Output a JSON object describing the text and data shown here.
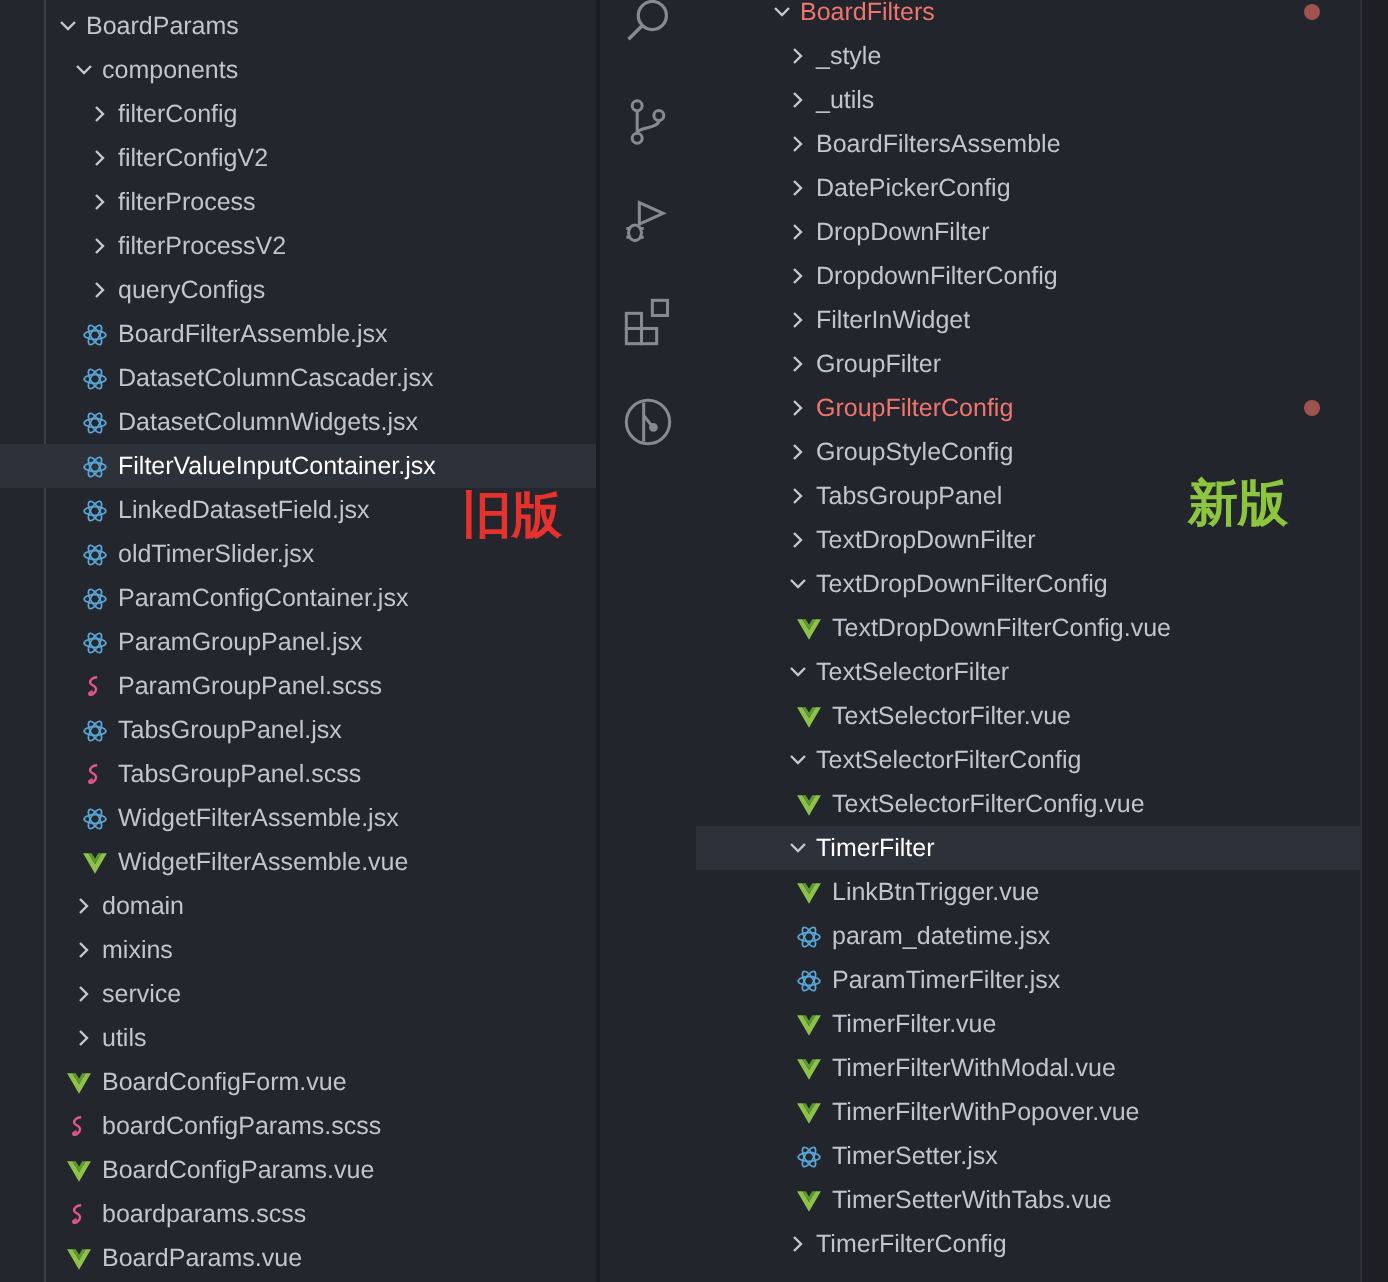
{
  "left_explorer": {
    "annotation": {
      "text": "旧版",
      "color": "#e5322d"
    },
    "tree": [
      {
        "kind": "folder",
        "name": "BoardParams",
        "expanded": true,
        "selected": false,
        "children": [
          {
            "kind": "folder",
            "name": "components",
            "expanded": true,
            "selected": false,
            "children": [
              {
                "kind": "folder",
                "name": "filterConfig",
                "expanded": false,
                "selected": false
              },
              {
                "kind": "folder",
                "name": "filterConfigV2",
                "expanded": false,
                "selected": false
              },
              {
                "kind": "folder",
                "name": "filterProcess",
                "expanded": false,
                "selected": false
              },
              {
                "kind": "folder",
                "name": "filterProcessV2",
                "expanded": false,
                "selected": false
              },
              {
                "kind": "folder",
                "name": "queryConfigs",
                "expanded": false,
                "selected": false
              },
              {
                "kind": "jsx",
                "name": "BoardFilterAssemble.jsx",
                "selected": false
              },
              {
                "kind": "jsx",
                "name": "DatasetColumnCascader.jsx",
                "selected": false
              },
              {
                "kind": "jsx",
                "name": "DatasetColumnWidgets.jsx",
                "selected": false
              },
              {
                "kind": "jsx",
                "name": "FilterValueInputContainer.jsx",
                "selected": true
              },
              {
                "kind": "jsx",
                "name": "LinkedDatasetField.jsx",
                "selected": false
              },
              {
                "kind": "jsx",
                "name": "oldTimerSlider.jsx",
                "selected": false
              },
              {
                "kind": "jsx",
                "name": "ParamConfigContainer.jsx",
                "selected": false
              },
              {
                "kind": "jsx",
                "name": "ParamGroupPanel.jsx",
                "selected": false
              },
              {
                "kind": "scss",
                "name": "ParamGroupPanel.scss",
                "selected": false
              },
              {
                "kind": "jsx",
                "name": "TabsGroupPanel.jsx",
                "selected": false
              },
              {
                "kind": "scss",
                "name": "TabsGroupPanel.scss",
                "selected": false
              },
              {
                "kind": "jsx",
                "name": "WidgetFilterAssemble.jsx",
                "selected": false
              },
              {
                "kind": "vue",
                "name": "WidgetFilterAssemble.vue",
                "selected": false
              }
            ]
          },
          {
            "kind": "folder",
            "name": "domain",
            "expanded": false,
            "selected": false
          },
          {
            "kind": "folder",
            "name": "mixins",
            "expanded": false,
            "selected": false
          },
          {
            "kind": "folder",
            "name": "service",
            "expanded": false,
            "selected": false
          },
          {
            "kind": "folder",
            "name": "utils",
            "expanded": false,
            "selected": false
          },
          {
            "kind": "vue",
            "name": "BoardConfigForm.vue",
            "selected": false
          },
          {
            "kind": "scss",
            "name": "boardConfigParams.scss",
            "selected": false
          },
          {
            "kind": "vue",
            "name": "BoardConfigParams.vue",
            "selected": false
          },
          {
            "kind": "scss",
            "name": "boardparams.scss",
            "selected": false
          },
          {
            "kind": "vue",
            "name": "BoardParams.vue",
            "selected": false
          }
        ]
      }
    ]
  },
  "right_explorer": {
    "annotation": {
      "text": "新版",
      "color": "#8cc63f"
    },
    "tree": [
      {
        "kind": "folder",
        "name": "BoardFilters",
        "expanded": true,
        "selected": false,
        "modified": true,
        "children": [
          {
            "kind": "folder",
            "name": "_style",
            "expanded": false,
            "selected": false,
            "modified": false
          },
          {
            "kind": "folder",
            "name": "_utils",
            "expanded": false,
            "selected": false,
            "modified": false
          },
          {
            "kind": "folder",
            "name": "BoardFiltersAssemble",
            "expanded": false,
            "selected": false,
            "modified": false
          },
          {
            "kind": "folder",
            "name": "DatePickerConfig",
            "expanded": false,
            "selected": false,
            "modified": false
          },
          {
            "kind": "folder",
            "name": "DropDownFilter",
            "expanded": false,
            "selected": false,
            "modified": false
          },
          {
            "kind": "folder",
            "name": "DropdownFilterConfig",
            "expanded": false,
            "selected": false,
            "modified": false
          },
          {
            "kind": "folder",
            "name": "FilterInWidget",
            "expanded": false,
            "selected": false,
            "modified": false
          },
          {
            "kind": "folder",
            "name": "GroupFilter",
            "expanded": false,
            "selected": false,
            "modified": false
          },
          {
            "kind": "folder",
            "name": "GroupFilterConfig",
            "expanded": false,
            "selected": false,
            "modified": true
          },
          {
            "kind": "folder",
            "name": "GroupStyleConfig",
            "expanded": false,
            "selected": false,
            "modified": false
          },
          {
            "kind": "folder",
            "name": "TabsGroupPanel",
            "expanded": false,
            "selected": false,
            "modified": false
          },
          {
            "kind": "folder",
            "name": "TextDropDownFilter",
            "expanded": false,
            "selected": false,
            "modified": false
          },
          {
            "kind": "folder",
            "name": "TextDropDownFilterConfig",
            "expanded": true,
            "selected": false,
            "modified": false,
            "children": [
              {
                "kind": "vue",
                "name": "TextDropDownFilterConfig.vue",
                "selected": false,
                "modified": false
              }
            ]
          },
          {
            "kind": "folder",
            "name": "TextSelectorFilter",
            "expanded": true,
            "selected": false,
            "modified": false,
            "children": [
              {
                "kind": "vue",
                "name": "TextSelectorFilter.vue",
                "selected": false,
                "modified": false
              }
            ]
          },
          {
            "kind": "folder",
            "name": "TextSelectorFilterConfig",
            "expanded": true,
            "selected": false,
            "modified": false,
            "children": [
              {
                "kind": "vue",
                "name": "TextSelectorFilterConfig.vue",
                "selected": false,
                "modified": false
              }
            ]
          },
          {
            "kind": "folder",
            "name": "TimerFilter",
            "expanded": true,
            "selected": true,
            "modified": false,
            "children": [
              {
                "kind": "vue",
                "name": "LinkBtnTrigger.vue",
                "selected": false,
                "modified": false
              },
              {
                "kind": "jsx",
                "name": "param_datetime.jsx",
                "selected": false,
                "modified": false
              },
              {
                "kind": "jsx",
                "name": "ParamTimerFilter.jsx",
                "selected": false,
                "modified": false
              },
              {
                "kind": "vue",
                "name": "TimerFilter.vue",
                "selected": false,
                "modified": false
              },
              {
                "kind": "vue",
                "name": "TimerFilterWithModal.vue",
                "selected": false,
                "modified": false
              },
              {
                "kind": "vue",
                "name": "TimerFilterWithPopover.vue",
                "selected": false,
                "modified": false
              },
              {
                "kind": "jsx",
                "name": "TimerSetter.jsx",
                "selected": false,
                "modified": false
              },
              {
                "kind": "vue",
                "name": "TimerSetterWithTabs.vue",
                "selected": false,
                "modified": false
              }
            ]
          },
          {
            "kind": "folder",
            "name": "TimerFilterConfig",
            "expanded": false,
            "selected": false,
            "modified": false
          }
        ]
      }
    ]
  }
}
